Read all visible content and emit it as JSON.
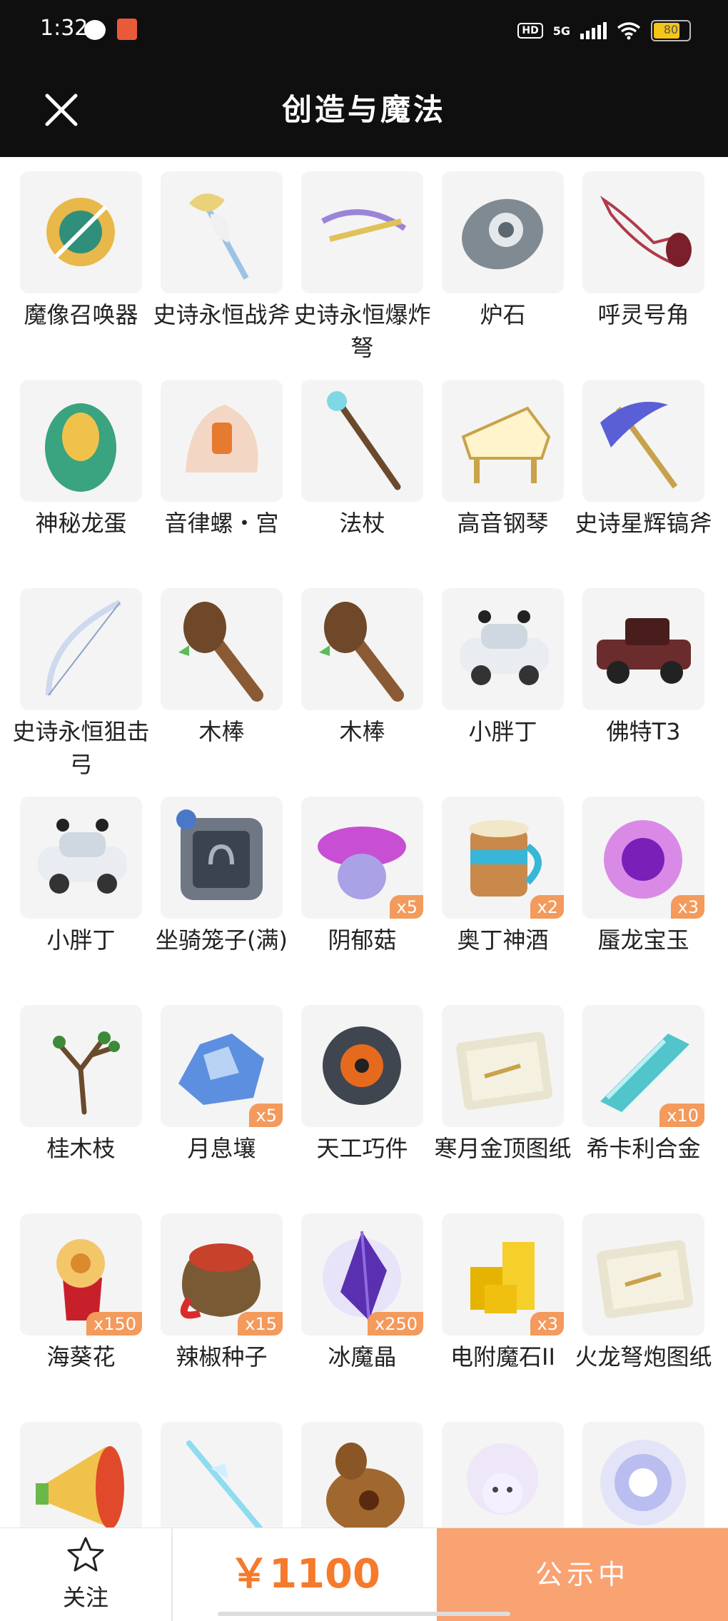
{
  "status_bar": {
    "time": "1:32",
    "hd": "HD",
    "network": "5G",
    "battery": "80"
  },
  "header": {
    "title": "创造与魔法"
  },
  "items": [
    {
      "name": "魔像召唤器",
      "badge": "",
      "icon": "summoner-icon"
    },
    {
      "name": "史诗永恒战斧",
      "badge": "",
      "icon": "battle-axe-icon"
    },
    {
      "name": "史诗永恒爆炸弩",
      "badge": "",
      "icon": "crossbow-icon"
    },
    {
      "name": "炉石",
      "badge": "",
      "icon": "hearthstone-icon"
    },
    {
      "name": "呼灵号角",
      "badge": "",
      "icon": "horn-icon"
    },
    {
      "name": "神秘龙蛋",
      "badge": "",
      "icon": "dragon-egg-icon"
    },
    {
      "name": "音律螺・宫",
      "badge": "",
      "icon": "conch-icon"
    },
    {
      "name": "法杖",
      "badge": "",
      "icon": "staff-icon"
    },
    {
      "name": "高音钢琴",
      "badge": "",
      "icon": "piano-icon"
    },
    {
      "name": "史诗星辉镐斧",
      "badge": "",
      "icon": "pickaxe-icon"
    },
    {
      "name": "史诗永恒狙击弓",
      "badge": "",
      "icon": "bow-icon"
    },
    {
      "name": "木棒",
      "badge": "",
      "icon": "club-icon"
    },
    {
      "name": "木棒",
      "badge": "",
      "icon": "club-icon"
    },
    {
      "name": "小胖丁",
      "badge": "",
      "icon": "car-icon"
    },
    {
      "name": "佛特T3",
      "badge": "",
      "icon": "vintage-car-icon"
    },
    {
      "name": "小胖丁",
      "badge": "",
      "icon": "car-icon"
    },
    {
      "name": "坐骑笼子(满)",
      "badge": "",
      "icon": "mount-cage-icon"
    },
    {
      "name": "阴郁菇",
      "badge": "x5",
      "icon": "mushroom-icon"
    },
    {
      "name": "奥丁神酒",
      "badge": "x2",
      "icon": "mead-mug-icon"
    },
    {
      "name": "蜃龙宝玉",
      "badge": "x3",
      "icon": "jade-orb-icon"
    },
    {
      "name": "桂木枝",
      "badge": "",
      "icon": "branch-icon"
    },
    {
      "name": "月息壤",
      "badge": "x5",
      "icon": "crystal-soil-icon"
    },
    {
      "name": "天工巧件",
      "badge": "",
      "icon": "gear-part-icon"
    },
    {
      "name": "寒月金顶图纸",
      "badge": "",
      "icon": "blueprint-icon"
    },
    {
      "name": "希卡利合金",
      "badge": "x10",
      "icon": "alloy-bar-icon"
    },
    {
      "name": "海葵花",
      "badge": "x150",
      "icon": "anemone-icon"
    },
    {
      "name": "辣椒种子",
      "badge": "x15",
      "icon": "seed-bag-icon"
    },
    {
      "name": "冰魔晶",
      "badge": "x250",
      "icon": "magic-crystal-icon"
    },
    {
      "name": "电附魔石II",
      "badge": "x3",
      "icon": "gold-stone-icon"
    },
    {
      "name": "火龙弩炮图纸",
      "badge": "",
      "icon": "blueprint-icon"
    },
    {
      "name": "",
      "badge": "",
      "icon": "megaphone-icon"
    },
    {
      "name": "",
      "badge": "",
      "icon": "ice-spear-icon"
    },
    {
      "name": "",
      "badge": "",
      "icon": "gourd-icon"
    },
    {
      "name": "",
      "badge": "",
      "icon": "sheep-icon"
    },
    {
      "name": "",
      "badge": "",
      "icon": "glow-orb-icon"
    }
  ],
  "bottom_bar": {
    "follow_label": "关注",
    "price": "￥1100",
    "status": "公示中"
  },
  "colors": {
    "accent": "#f57a2b",
    "publish_bg": "#f9a272",
    "badge_bg": "#f39a5c",
    "header_bg": "#0f0f0f"
  }
}
